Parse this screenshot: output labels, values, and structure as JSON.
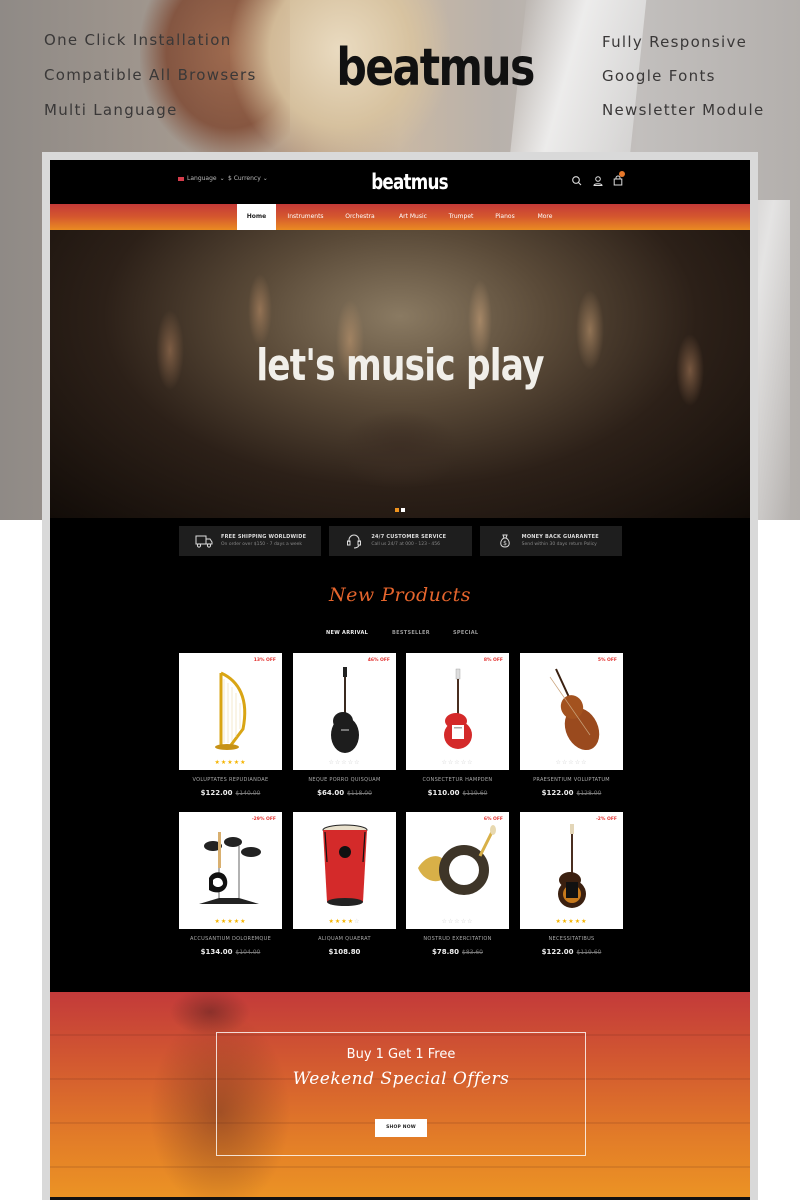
{
  "showcase": {
    "logo": "beatmus",
    "features_left": [
      "One Click Installation",
      "Compatible All Browsers",
      "Multi Language"
    ],
    "features_right": [
      "Fully Responsive",
      "Google Fonts",
      "Newsletter Module"
    ]
  },
  "header": {
    "language_label": "Language",
    "currency_label": "$ Currency",
    "logo": "beatmus",
    "icons": [
      "search-icon",
      "user-icon",
      "cart-icon"
    ],
    "cart_badge_color": "#e8782a"
  },
  "nav": {
    "items": [
      "Home",
      "Instruments",
      "Orchestra",
      "Art Music",
      "Trumpet",
      "Pianos",
      "More"
    ],
    "active_index": 0,
    "gradient": [
      "#c43a38",
      "#ea8b22"
    ]
  },
  "slider": {
    "headline": "let's music play",
    "slide_count": 2,
    "active_slide": 0
  },
  "services": [
    {
      "icon": "truck-icon",
      "title": "FREE SHIPPING WORLDWIDE",
      "subtitle": "On order over $150 - 7 days a week"
    },
    {
      "icon": "headset-icon",
      "title": "24/7 CUSTOMER SERVICE",
      "subtitle": "Call us 24/7 at 000 - 123 - 456"
    },
    {
      "icon": "money-bag-icon",
      "title": "MONEY BACK GUARANTEE",
      "subtitle": "Send within 30 days return Policy"
    }
  ],
  "products_section": {
    "title": "New Products",
    "tabs": [
      "NEW ARRIVAL",
      "BESTSELLER",
      "SPECIAL"
    ],
    "active_tab": 0,
    "products": [
      {
        "name": "VOLUPTATES REPUDIANDAE",
        "price": "$122.00",
        "old_price": "$140.00",
        "discount": "13% OFF",
        "rating": 5,
        "image": "harp"
      },
      {
        "name": "NEQUE PORRO QUISQUAM",
        "price": "$64.00",
        "old_price": "$118.00",
        "discount": "46% OFF",
        "rating": 0,
        "image": "black-guitar"
      },
      {
        "name": "CONSECTETUR HAMPDEN",
        "price": "$110.00",
        "old_price": "$119.60",
        "discount": "8% OFF",
        "rating": 0,
        "image": "red-guitar"
      },
      {
        "name": "PRAESENTIUM VOLUPTATUM",
        "price": "$122.00",
        "old_price": "$128.00",
        "discount": "5% OFF",
        "rating": 0,
        "image": "cello"
      },
      {
        "name": "ACCUSANTIUM DOLOREMQUE",
        "price": "$134.00",
        "old_price": "$104.00",
        "discount": "-29% OFF",
        "rating": 5,
        "image": "drum-kit"
      },
      {
        "name": "ALIQUAM QUAERAT",
        "price": "$108.80",
        "old_price": "",
        "discount": "",
        "rating": 4,
        "image": "red-drum"
      },
      {
        "name": "NOSTRUD EXERCITATION",
        "price": "$78.80",
        "old_price": "$83.60",
        "discount": "6% OFF",
        "rating": 0,
        "image": "horn"
      },
      {
        "name": "NECESSITATIBUS",
        "price": "$122.00",
        "old_price": "$119.60",
        "discount": "-2% OFF",
        "rating": 5,
        "image": "sunburst-guitar"
      }
    ]
  },
  "promo": {
    "line1": "Buy 1 Get 1 Free",
    "line2": "Weekend Special Offers",
    "button": "SHOP NOW"
  },
  "colors": {
    "accent": "#e5652d",
    "discount": "#e2302e",
    "star": "#f5b400",
    "star_empty": "#cccccc"
  }
}
